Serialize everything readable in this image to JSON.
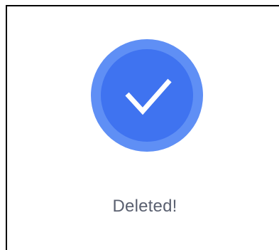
{
  "dialog": {
    "message": "Deleted!",
    "icon": "check-circle-icon"
  },
  "colors": {
    "badge_outer": "#5f8ff5",
    "badge_inner": "#3f73f0",
    "check": "#ffffff",
    "message_text": "#5a6070",
    "frame_border": "#000000"
  }
}
